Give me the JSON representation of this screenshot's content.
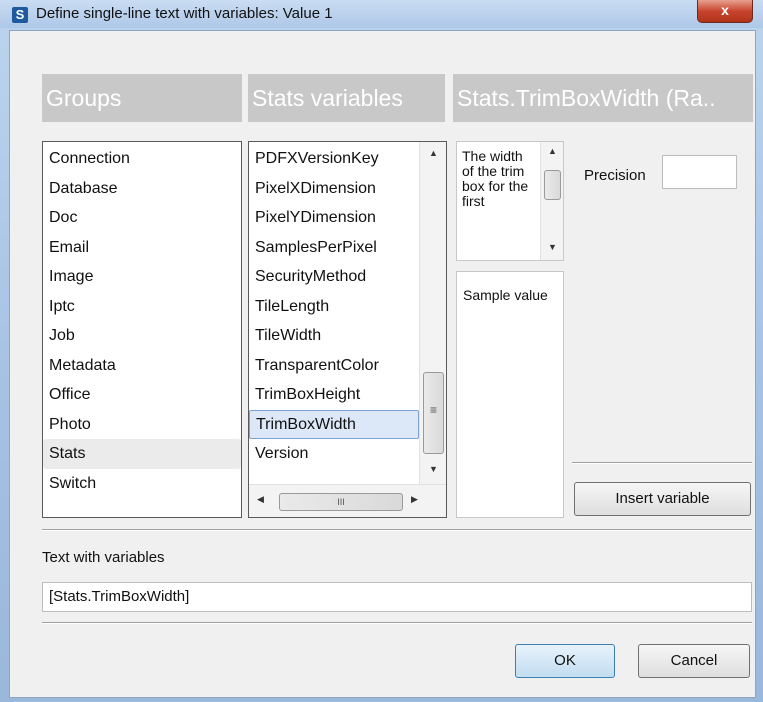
{
  "window": {
    "title": "Define single-line text with variables: Value 1",
    "app_icon_letter": "S",
    "close_glyph": "x"
  },
  "columns": {
    "groups_header": "Groups",
    "variables_header": "Stats variables",
    "detail_header": "Stats.TrimBoxWidth (Ra.."
  },
  "groups": {
    "items": [
      "Connection",
      "Database",
      "Doc",
      "Email",
      "Image",
      "Iptc",
      "Job",
      "Metadata",
      "Office",
      "Photo",
      "Stats",
      "Switch"
    ],
    "selected": "Stats"
  },
  "variables": {
    "items": [
      "PDFXVersionKey",
      "PixelXDimension",
      "PixelYDimension",
      "SamplesPerPixel",
      "SecurityMethod",
      "TileLength",
      "TileWidth",
      "TransparentColor",
      "TrimBoxHeight",
      "TrimBoxWidth",
      "Version"
    ],
    "selected": "TrimBoxWidth"
  },
  "detail": {
    "description": "The width of the trim box for the first",
    "sample_value": "Sample value",
    "precision_label": "Precision",
    "precision_value": "",
    "insert_button": "Insert variable"
  },
  "text_section": {
    "label": "Text with variables",
    "value": "[Stats.TrimBoxWidth]"
  },
  "footer": {
    "ok_label": "OK",
    "cancel_label": "Cancel"
  },
  "icons": {
    "scroll_up": "▲",
    "scroll_down": "▼",
    "scroll_left": "◀",
    "scroll_right": "▶",
    "thumb_grip": "≡",
    "hthumb_grip": "III"
  }
}
